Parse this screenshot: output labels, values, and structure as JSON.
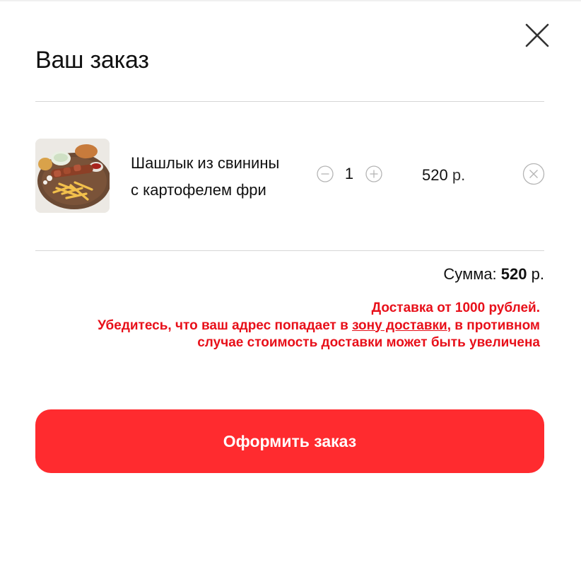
{
  "modal": {
    "title": "Ваш заказ"
  },
  "cart": {
    "items": [
      {
        "name_line1": "Шашлык из свинины",
        "name_line2": "с картофелем фри",
        "quantity": "1",
        "price_value": "520",
        "price_currency": "р."
      }
    ]
  },
  "summary": {
    "label": "Сумма:",
    "value": "520",
    "currency": "р."
  },
  "notice": {
    "line1": "Доставка от 1000 рублей.",
    "line2_before": "Убедитесь, что ваш адрес попадает в ",
    "line2_link": "зону доставки",
    "line2_after": ", в противном",
    "line3": "случае стоимость доставки может быть увеличена"
  },
  "checkout": {
    "label": "Оформить заказ"
  },
  "icons": {
    "close": "close-icon",
    "minus": "minus-circle-icon",
    "plus": "plus-circle-icon",
    "remove": "remove-circle-icon"
  },
  "colors": {
    "accent": "#ff2b2f",
    "warning_text": "#e8101a",
    "divider": "#d6d6d6",
    "icon_gray": "#b5b5b5"
  }
}
